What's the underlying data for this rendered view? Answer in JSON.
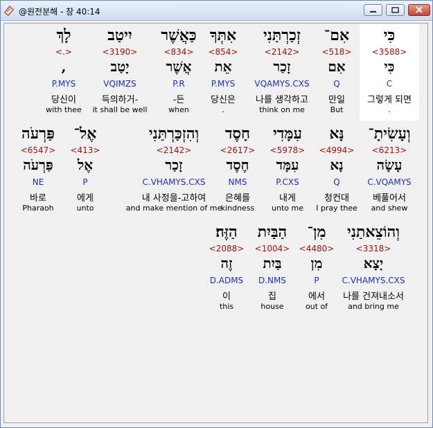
{
  "window": {
    "title": "@원전분해 - 창 40:14",
    "controls": {
      "minimize": "minimize-icon",
      "maximize": "maximize-icon",
      "close": "close-icon"
    }
  },
  "colors": {
    "strong": "#a01010",
    "parse": "#1c2ec0",
    "selected_bg": "#ffffff"
  },
  "rows": [
    {
      "words": [
        {
          "hebrew": "כִּי",
          "strong": "<3588>",
          "lemma": "כִּי",
          "parse": "C",
          "korean": "그렇게 되면",
          "english": ".",
          "selected": true
        },
        {
          "hebrew": "אִם־",
          "strong": "<518>",
          "lemma": "אִם",
          "parse": "Q",
          "korean": "만일",
          "english": "But"
        },
        {
          "hebrew": "זְכַרְתַּנִי",
          "strong": "<2142>",
          "lemma": "זָכַר",
          "parse": "VQAMYS.CXS",
          "korean": "나를 생각하고",
          "english": "think on me"
        },
        {
          "hebrew": "אִתְּךָ",
          "strong": "<854>",
          "lemma": "אֵת",
          "parse": "P.MYS",
          "korean": "당신은",
          "english": "."
        },
        {
          "hebrew": "כַּאֲשֶׁר",
          "strong": "<834>",
          "lemma": "אֲשֶׁר",
          "parse": "P.R",
          "korean": "-든",
          "english": "when"
        },
        {
          "hebrew": "יִיטַב",
          "strong": "<3190>",
          "lemma": "יָטַב",
          "parse": "VQIMZS",
          "korean": "득의하거-",
          "english": "it shall be well"
        },
        {
          "hebrew": "לָךְ",
          "strong": "<.>",
          "lemma": ",",
          "parse": "P.MYS",
          "korean": "당신이",
          "english": "with thee"
        }
      ]
    },
    {
      "words": [
        {
          "hebrew": "וְעָשִׂיתָ־",
          "strong": "<6213>",
          "lemma": "עָשָׂה",
          "parse": "C.VQAMYS",
          "korean": "베풀어서",
          "english": "and shew"
        },
        {
          "hebrew": "נָּא",
          "strong": "<4994>",
          "lemma": "נָא",
          "parse": "Q",
          "korean": "청컨대",
          "english": "I pray thee"
        },
        {
          "hebrew": "עִמָּדִי",
          "strong": "<5978>",
          "lemma": "עִמָּד",
          "parse": "P.CXS",
          "korean": "내게",
          "english": "unto me"
        },
        {
          "hebrew": "חָסֶד",
          "strong": "<2617>",
          "lemma": "חֶסֶד",
          "parse": "NMS",
          "korean": "은혜를",
          "english": "kindness"
        },
        {
          "hebrew": "וְהִזְכַּרְתַּנִי",
          "strong": "<2142>",
          "lemma": "זָכַר",
          "parse": "C.VHAMYS.CXS",
          "korean": "내 사정을-고하여",
          "english": "and make mention of me"
        },
        {
          "hebrew": "אֶל־",
          "strong": "<413>",
          "lemma": "אֶל",
          "parse": "P",
          "korean": "에게",
          "english": "unto"
        },
        {
          "hebrew": "פַּרְעֹה",
          "strong": "<6547>",
          "lemma": "פַּרְעֹה",
          "parse": "NE",
          "korean": "바로",
          "english": "Pharaoh"
        }
      ]
    },
    {
      "words": [
        {
          "hebrew": "וְהוֹצֵאתַנִי",
          "strong": "<3318>",
          "lemma": "יָצָא",
          "parse": "C.VHAMYS.CXS",
          "korean": "나를 건져내소서",
          "english": "and bring me"
        },
        {
          "hebrew": "מִן־",
          "strong": "<4480>",
          "lemma": "מִן",
          "parse": "P",
          "korean": "에서",
          "english": "out of"
        },
        {
          "hebrew": "הַבַּיִת",
          "strong": "<1004>",
          "lemma": "בַּיִת",
          "parse": "D.NMS",
          "korean": "집",
          "english": "house"
        },
        {
          "hebrew": "הַזֶּה׃",
          "strong": "<2088>",
          "lemma": "זֶה",
          "parse": "D.ADMS",
          "korean": "이",
          "english": "this"
        }
      ]
    }
  ]
}
